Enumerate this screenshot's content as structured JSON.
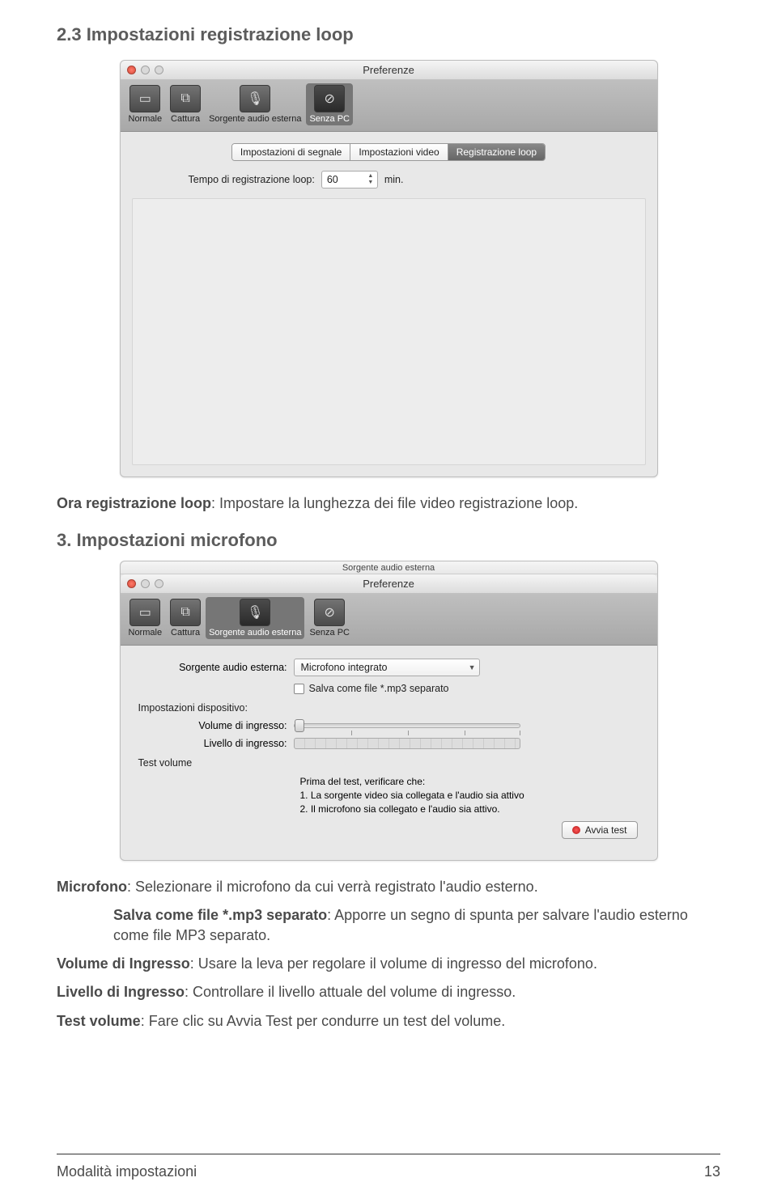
{
  "section_title": "2.3 Impostazioni registrazione loop",
  "window1": {
    "title": "Preferenze",
    "toolbar": {
      "items": [
        {
          "label": "Normale"
        },
        {
          "label": "Cattura"
        },
        {
          "label": "Sorgente audio esterna"
        },
        {
          "label": "Senza PC"
        }
      ]
    },
    "tabs": {
      "items": [
        {
          "label": "Impostazioni di segnale"
        },
        {
          "label": "Impostazioni video"
        },
        {
          "label": "Registrazione loop"
        }
      ]
    },
    "loop_label": "Tempo di registrazione loop:",
    "loop_value": "60",
    "loop_unit": "min."
  },
  "para_loop": {
    "bold": "Ora registrazione loop",
    "rest": ": Impostare la lunghezza dei file video registrazione loop."
  },
  "heading2": "3. Impostazioni microfono",
  "window2": {
    "sub_title": "Sorgente audio esterna",
    "title": "Preferenze",
    "toolbar": {
      "items": [
        {
          "label": "Normale"
        },
        {
          "label": "Cattura"
        },
        {
          "label": "Sorgente audio esterna"
        },
        {
          "label": "Senza PC"
        }
      ]
    },
    "source_label": "Sorgente audio esterna:",
    "source_value": "Microfono integrato",
    "save_mp3_label": "Salva come file *.mp3 separato",
    "device_settings_label": "Impostazioni dispositivo:",
    "vol_in_label": "Volume di ingresso:",
    "lvl_in_label": "Livello di ingresso:",
    "test_volume_label": "Test volume",
    "instr_intro": "Prima del test, verificare che:",
    "instr_1": "1. La sorgente video sia collegata e l'audio sia attivo",
    "instr_2": "2. Il microfono sia collegato e l'audio sia attivo.",
    "start_test_btn": "Avvia test"
  },
  "para_mic": {
    "bold": "Microfono",
    "rest": ": Selezionare il microfono da cui verrà registrato l'audio esterno."
  },
  "para_mp3": {
    "bold": "Salva come file *.mp3 separato",
    "rest": ": Apporre un segno di spunta per salvare l'audio esterno come file MP3 separato."
  },
  "para_volin": {
    "bold": "Volume di Ingresso",
    "rest": ": Usare la leva per regolare il volume di ingresso del microfono."
  },
  "para_lvlin": {
    "bold": "Livello di Ingresso",
    "rest": ": Controllare il livello attuale del volume di ingresso."
  },
  "para_testvol": {
    "bold": "Test volume",
    "rest": ": Fare clic su Avvia Test per condurre un test del volume."
  },
  "footer": {
    "left": "Modalità impostazioni",
    "right": "13"
  }
}
